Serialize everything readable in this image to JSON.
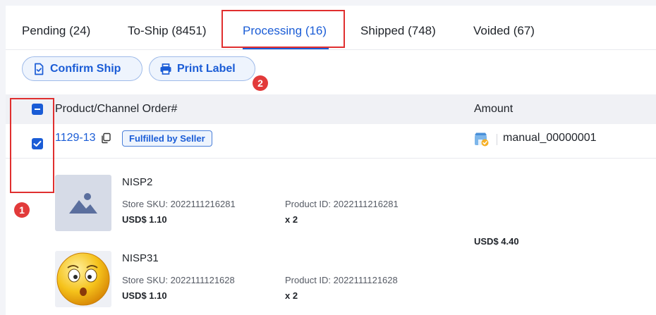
{
  "tabs": [
    {
      "label": "Pending (24)"
    },
    {
      "label": "To-Ship (8451)"
    },
    {
      "label": "Processing (16)"
    },
    {
      "label": "Shipped (748)"
    },
    {
      "label": "Voided (67)"
    }
  ],
  "toolbar": {
    "confirm_ship_label": "Confirm Ship",
    "print_label_label": "Print Label"
  },
  "annotations": {
    "badge_1": "1",
    "badge_2": "2",
    "highlight_color": "#e02f2f"
  },
  "table": {
    "columns": [
      "Product/Channel Order#",
      "Amount"
    ]
  },
  "order": {
    "id": "1129-13",
    "tag": "Fulfilled by Seller",
    "channel_order": "manual_00000001",
    "total": "USD$ 4.40",
    "store_icon": "store-icon",
    "copy_icon": "copy-icon",
    "products": [
      {
        "name": "NISP2",
        "store_sku": "Store SKU: 2022111216281",
        "product_id": "Product ID: 2022111216281",
        "price": "USD$ 1.10",
        "qty": "x 2",
        "image": "placeholder-image-icon"
      },
      {
        "name": "NISP31",
        "store_sku": "Store SKU: 2022111121628",
        "product_id": "Product ID: 2022111121628",
        "price": "USD$ 1.10",
        "qty": "x 2",
        "image": "emoji-face-icon"
      }
    ]
  },
  "colors": {
    "accent": "#1a5cd6",
    "badge": "#e23a3a"
  }
}
